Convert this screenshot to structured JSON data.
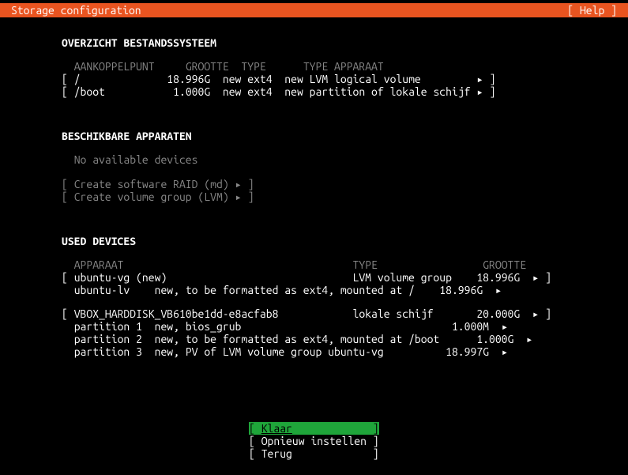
{
  "header": {
    "title": "Storage configuration",
    "help": "[ Help ]"
  },
  "fs": {
    "title": "OVERZICHT BESTANDSSYSTEEM",
    "cols": {
      "mount": "AANKOPPELPUNT",
      "size": "GROOTTE",
      "type": "TYPE",
      "devtype": "TYPE APPARAAT"
    },
    "rows": [
      {
        "mount": "/",
        "size": "18.996G",
        "type": "new ext4",
        "devtype": "new LVM logical volume"
      },
      {
        "mount": "/boot",
        "size": "1.000G",
        "type": "new ext4",
        "devtype": "new partition of lokale schijf"
      }
    ]
  },
  "avail": {
    "title": "BESCHIKBARE APPARATEN",
    "none": "No available devices",
    "raid": "Create software RAID (md)",
    "lvm": "Create volume group (LVM)"
  },
  "used": {
    "title": "USED DEVICES",
    "cols": {
      "dev": "APPARAAT",
      "type": "TYPE",
      "size": "GROOTTE"
    },
    "dev1": {
      "name": "ubuntu-vg (new)",
      "type": "LVM volume group",
      "size": "18.996G",
      "child": {
        "name": "ubuntu-lv",
        "desc": "new, to be formatted as ext4, mounted at /",
        "size": "18.996G"
      }
    },
    "dev2": {
      "name": "VBOX_HARDDISK_VB610be1dd-e8acfab8",
      "type": "lokale schijf",
      "size": "20.000G",
      "p1": {
        "name": "partition 1",
        "desc": "new, bios_grub",
        "size": "1.000M"
      },
      "p2": {
        "name": "partition 2",
        "desc": "new, to be formatted as ext4, mounted at /boot",
        "size": "1.000G"
      },
      "p3": {
        "name": "partition 3",
        "desc": "new, PV of LVM volume group ubuntu-vg",
        "size": "18.997G"
      }
    }
  },
  "buttons": {
    "done": "Klaar",
    "reset": "Opnieuw instellen",
    "back": "Terug"
  }
}
